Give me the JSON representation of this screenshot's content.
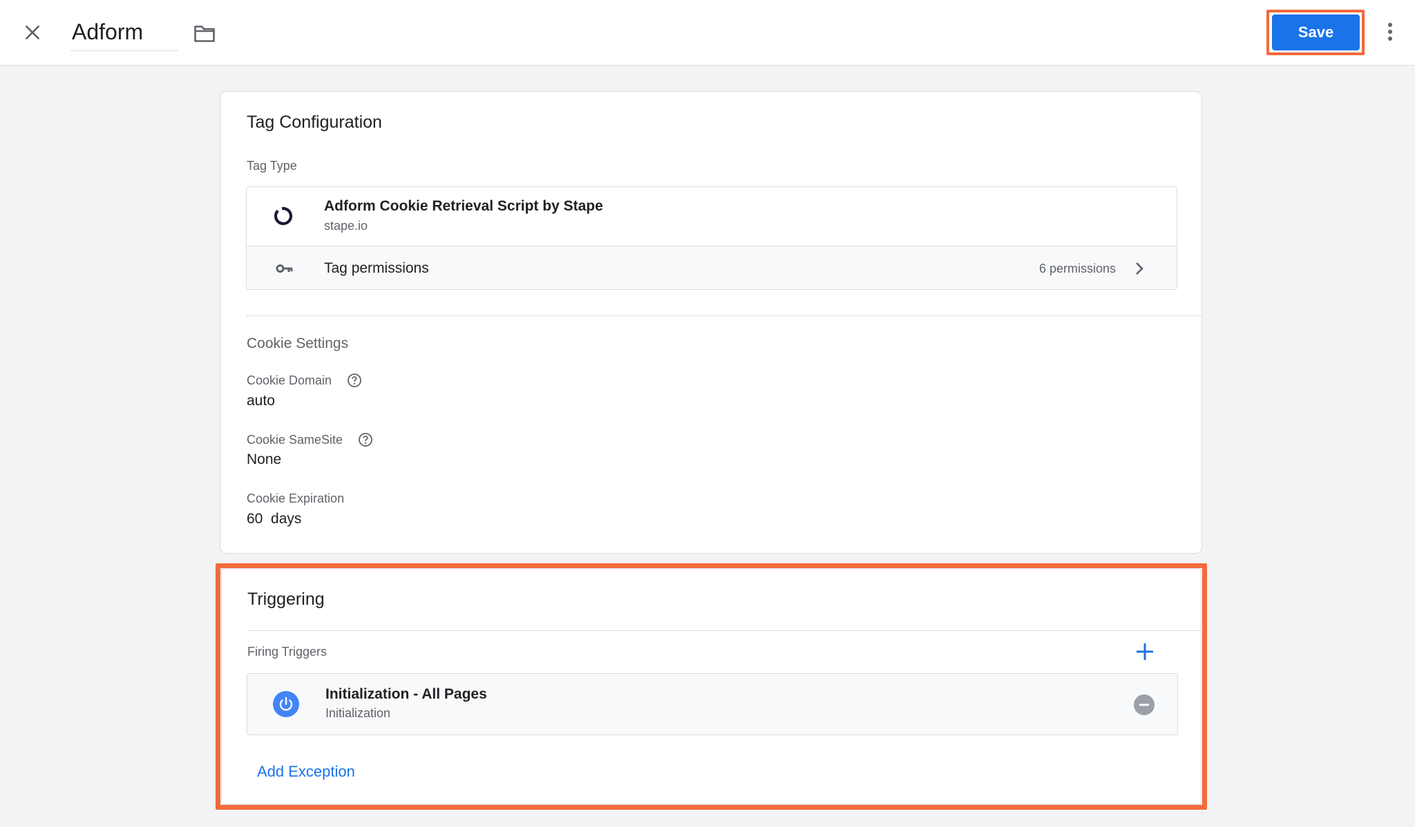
{
  "header": {
    "tag_name": "Adform",
    "save_label": "Save"
  },
  "tag_configuration": {
    "title": "Tag Configuration",
    "tag_type_label": "Tag Type",
    "tag_type": {
      "name": "Adform Cookie Retrieval Script by Stape",
      "vendor": "stape.io"
    },
    "permissions": {
      "label": "Tag permissions",
      "count": "6 permissions"
    },
    "cookie_settings": {
      "heading": "Cookie Settings",
      "domain_label": "Cookie Domain",
      "domain_value": "auto",
      "samesite_label": "Cookie SameSite",
      "samesite_value": "None",
      "expiration_label": "Cookie Expiration",
      "expiration_value": "60  days"
    }
  },
  "triggering": {
    "title": "Triggering",
    "firing_label": "Firing Triggers",
    "triggers": [
      {
        "name": "Initialization - All Pages",
        "type": "Initialization"
      }
    ],
    "add_exception_label": "Add Exception"
  },
  "colors": {
    "primary": "#1a73e8",
    "highlight": "#f26b3a",
    "trigger_icon": "#4285f4",
    "background": "#f1f3f4"
  },
  "icons": {
    "close": "close-icon",
    "folder": "folder-icon",
    "more": "more-vert-icon",
    "tag_type": "ring-icon",
    "permissions": "key-icon",
    "chevron": "chevron-right-icon",
    "help": "help-icon",
    "add_trigger": "plus-icon",
    "trigger": "power-icon",
    "remove_trigger": "remove-circle-icon"
  }
}
